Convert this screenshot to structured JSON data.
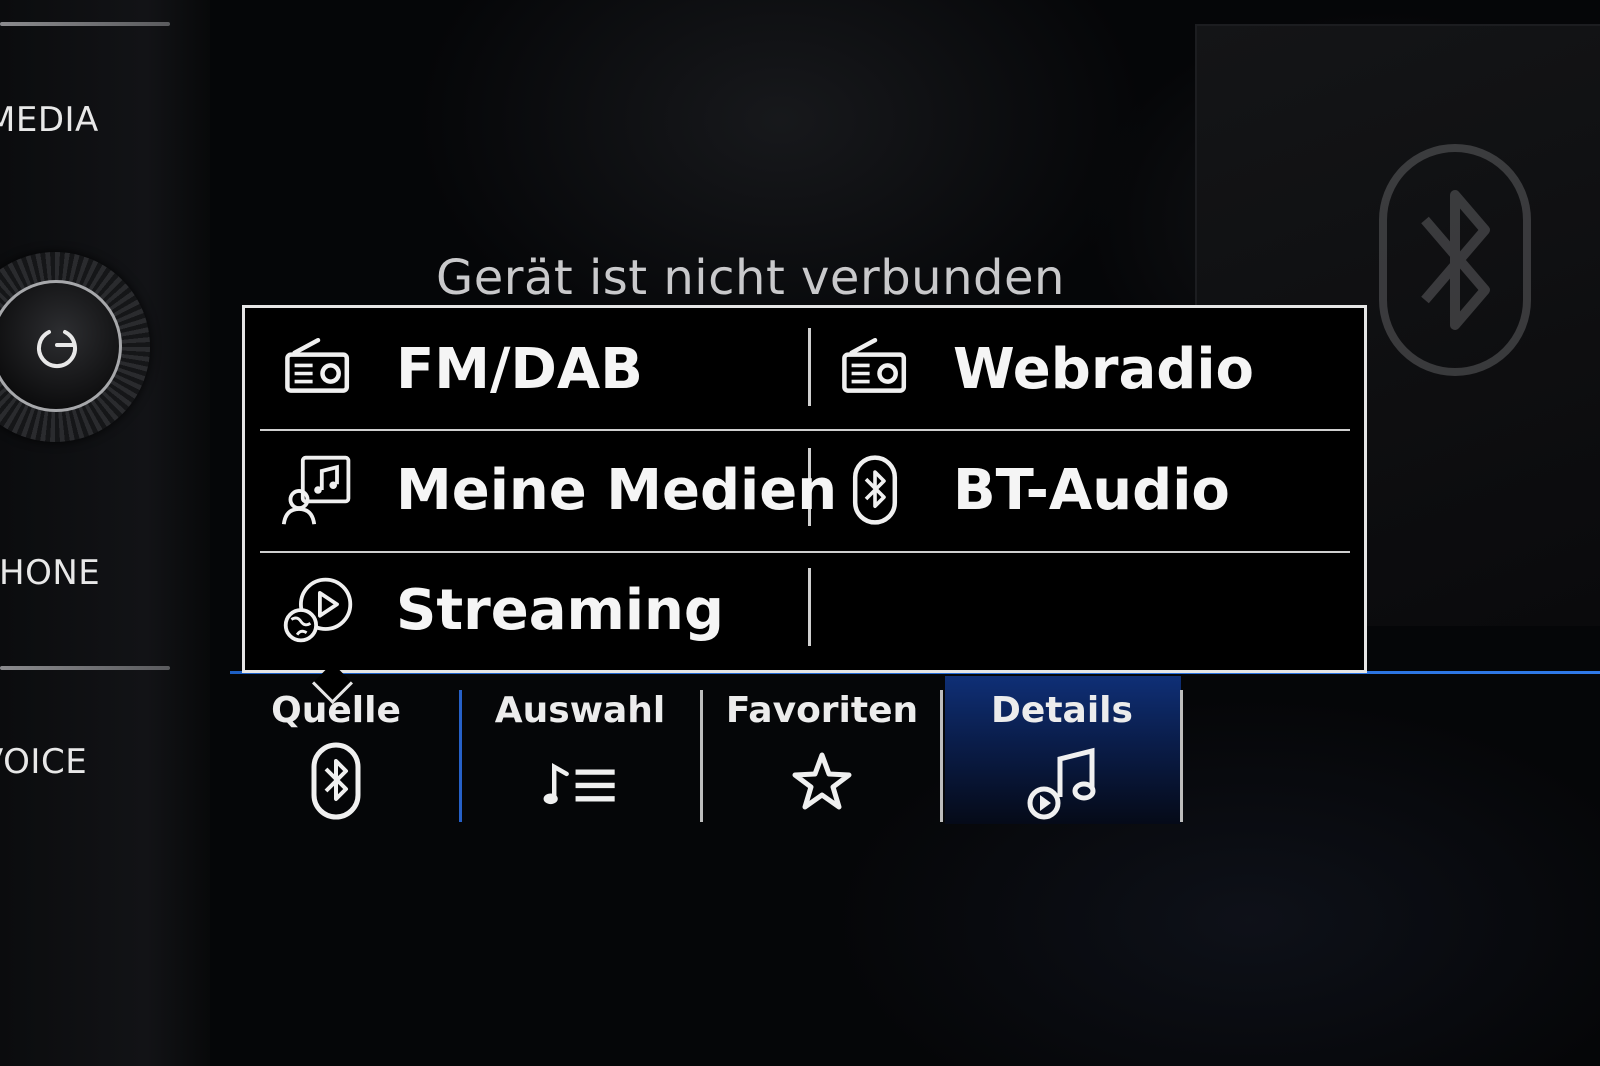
{
  "side_buttons": {
    "media_label": "MEDIA",
    "phone_label": "PHONE",
    "voice_label": "VOICE"
  },
  "status": {
    "message": "Gerät ist nicht verbunden"
  },
  "source_menu": {
    "items": [
      {
        "label": "FM/DAB",
        "icon": "radio-icon"
      },
      {
        "label": "Webradio",
        "icon": "radio-icon"
      },
      {
        "label": "Meine Medien",
        "icon": "my-media-icon"
      },
      {
        "label": "BT-Audio",
        "icon": "bluetooth-icon"
      },
      {
        "label": "Streaming",
        "icon": "streaming-icon"
      }
    ]
  },
  "tabs": [
    {
      "label": "Quelle",
      "icon": "bluetooth-icon",
      "active": false
    },
    {
      "label": "Auswahl",
      "icon": "playlist-icon",
      "active": false
    },
    {
      "label": "Favoriten",
      "icon": "star-icon",
      "active": false
    },
    {
      "label": "Details",
      "icon": "music-note-icon",
      "active": true
    }
  ],
  "colors": {
    "accent_blue": "#2f79e8",
    "active_tab": "#0f2f76",
    "text": "#f2f2f2",
    "background": "#050608"
  }
}
